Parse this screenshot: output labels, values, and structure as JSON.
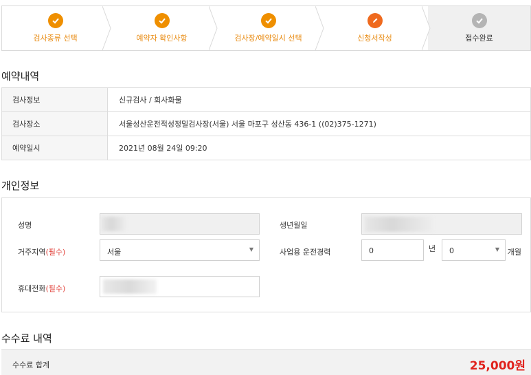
{
  "steps": [
    {
      "label": "검사종류 선택",
      "state": "done"
    },
    {
      "label": "예약자 확인사항",
      "state": "done"
    },
    {
      "label": "검사장/예약일시 선택",
      "state": "done"
    },
    {
      "label": "신청서작성",
      "state": "current"
    },
    {
      "label": "접수완료",
      "state": "pending"
    }
  ],
  "reservation": {
    "title": "예약내역",
    "rows": [
      {
        "label": "검사정보",
        "value": "신규검사 / 회사화물"
      },
      {
        "label": "검사장소",
        "value": "서울성산운전적성정밀검사장(서울) 서울 마포구 성산동 436-1 ((02)375-1271)"
      },
      {
        "label": "예약일시",
        "value": "2021년 08월 24일 09:20"
      }
    ]
  },
  "personal": {
    "title": "개인정보",
    "name_label": "성명",
    "birth_label": "생년월일",
    "region_label": "거주지역",
    "required_mark": "(필수)",
    "region_value": "서울",
    "career_label": "사업용 운전경력",
    "career_years": "0",
    "years_unit": "년",
    "career_months": "0",
    "months_unit": "개월",
    "phone_label": "휴대전화"
  },
  "fee": {
    "title": "수수료 내역",
    "total_label": "수수료 합계",
    "total_value": "25,000원"
  },
  "colors": {
    "accent": "#ef8f00",
    "current": "#ef6a1e",
    "pending": "#b4b4b4",
    "required": "#e2463f",
    "fee": "#e0231d"
  }
}
